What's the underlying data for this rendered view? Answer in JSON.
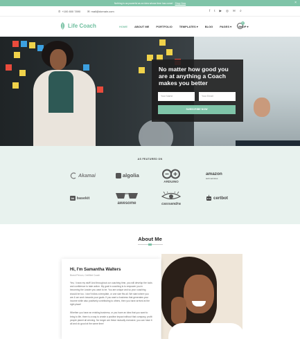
{
  "announcement": {
    "text": "Nothing is as powerful as an idea whose time has come!",
    "link": "Shop Now",
    "close": "×"
  },
  "topbar": {
    "phone": "+100 800 7890",
    "email": "mail@domain.com",
    "social_icons": [
      "facebook-icon",
      "twitter-icon",
      "youtube-icon",
      "instagram-icon",
      "email-icon"
    ]
  },
  "header": {
    "logo_text": "Life Coach",
    "nav": [
      "HOME",
      "ABOUT ME",
      "PORTFOLIO",
      "TEMPLATES ▾",
      "BLOG",
      "PAGES ▾",
      "SHOP ▾"
    ],
    "cart_count": "0"
  },
  "hero": {
    "headline": "No matter how good you are at anything a Coach makes you better",
    "name_placeholder": "Your Name",
    "email_placeholder": "Your Email",
    "button": "SUBSCRIBE NOW"
  },
  "featured": {
    "label": "AS FEATURED ON",
    "logos": [
      "Akamai",
      "algolia",
      "ARDUINO",
      "amazon",
      "basekit",
      "awesome",
      "cassandra",
      "certbot"
    ],
    "amazon_sub": "web services"
  },
  "about": {
    "title": "About Me",
    "name": "Hi, I'm Samantha Walters",
    "role": "Brand Person, Certified Coach",
    "para1": "Yes, I know my stuff! And throughout our coaching time, you will develop the tools and confidence to take action. My goal in coaching is to empower you in becoming the Leader you want to be. You are unique and so your coaching should be too. I don't follow a template, or one size fits all. We start where you are & we work towards your goals. If you want a business that generates your income while also positively contributing to others, then you have arrived at the right place!",
    "para2": "Whether you have an existing business, or you have an idea that you want to bring to life, there is a way to create a positive impact without that company, profit people planet all winning. No longer are these mutually exclusive, you can have it all and do good at the same time!"
  },
  "colors": {
    "accent": "#7fc4a8",
    "featured_bg": "#e8f2ee",
    "card_bg": "#1e1e1e"
  }
}
